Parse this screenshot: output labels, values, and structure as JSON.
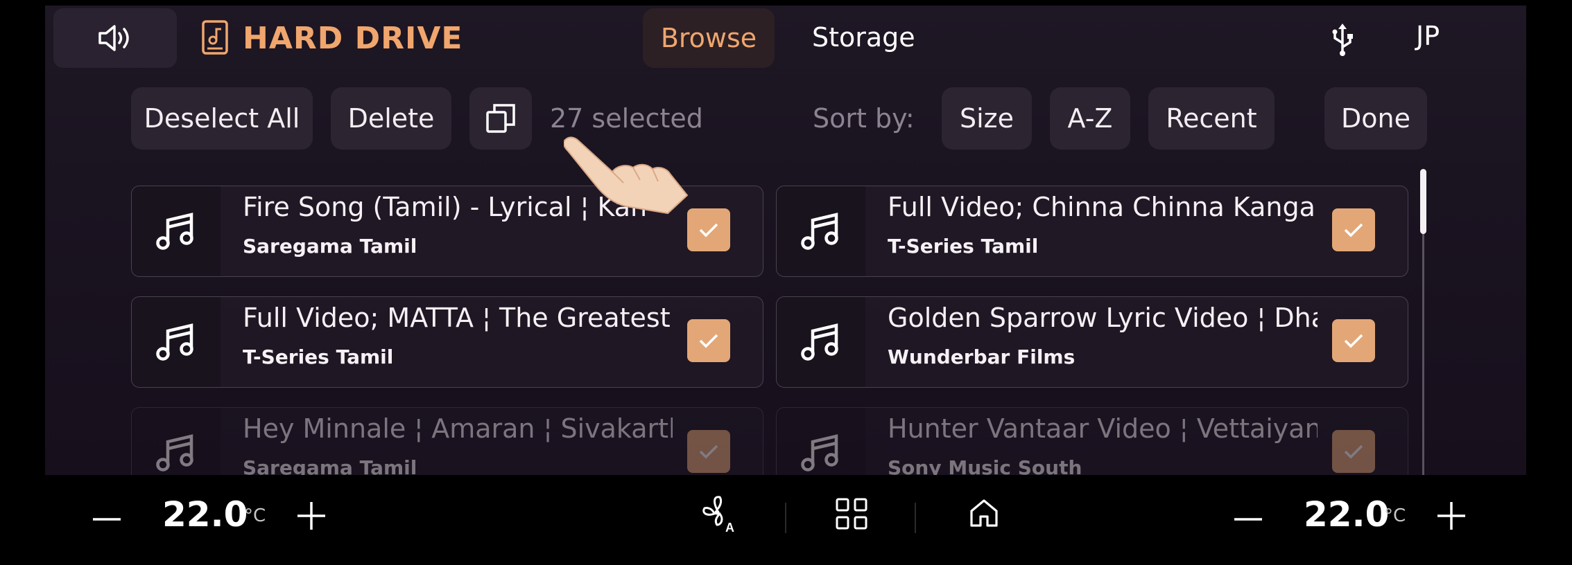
{
  "header": {
    "title": "HARD DRIVE",
    "tabs": [
      {
        "label": "Browse",
        "active": true
      },
      {
        "label": "Storage",
        "active": false
      }
    ],
    "language": "JP"
  },
  "toolbar": {
    "deselect_all": "Deselect All",
    "delete": "Delete",
    "selected_count": "27 selected",
    "sort_by": "Sort by:",
    "sort_options": [
      "Size",
      "A-Z",
      "Recent"
    ],
    "done": "Done"
  },
  "tracks": [
    {
      "title": "Fire Song (Tamil) - Lyrical ¦ Kan",
      "artist": "Saregama Tamil",
      "checked": true
    },
    {
      "title": "Full Video; Chinna Chinna Kangal",
      "artist": "T-Series Tamil",
      "checked": true
    },
    {
      "title": "Full Video; MATTA ¦ The Greatest",
      "artist": "T-Series Tamil",
      "checked": true
    },
    {
      "title": "Golden Sparrow Lyric Video ¦ Dhan",
      "artist": "Wunderbar Films",
      "checked": true
    },
    {
      "title": "Hey Minnale ¦ Amaran ¦ Sivakarthi",
      "artist": "Saregama Tamil",
      "checked": true
    },
    {
      "title": "Hunter Vantaar Video ¦ Vettaiyan",
      "artist": "Sony Music South",
      "checked": true
    }
  ],
  "climate": {
    "left_temp": "22.0",
    "right_temp": "22.0",
    "unit": "°C"
  },
  "colors": {
    "accent": "#f0a66d",
    "checkbox": "#e3a777",
    "background": "#1a1320"
  }
}
